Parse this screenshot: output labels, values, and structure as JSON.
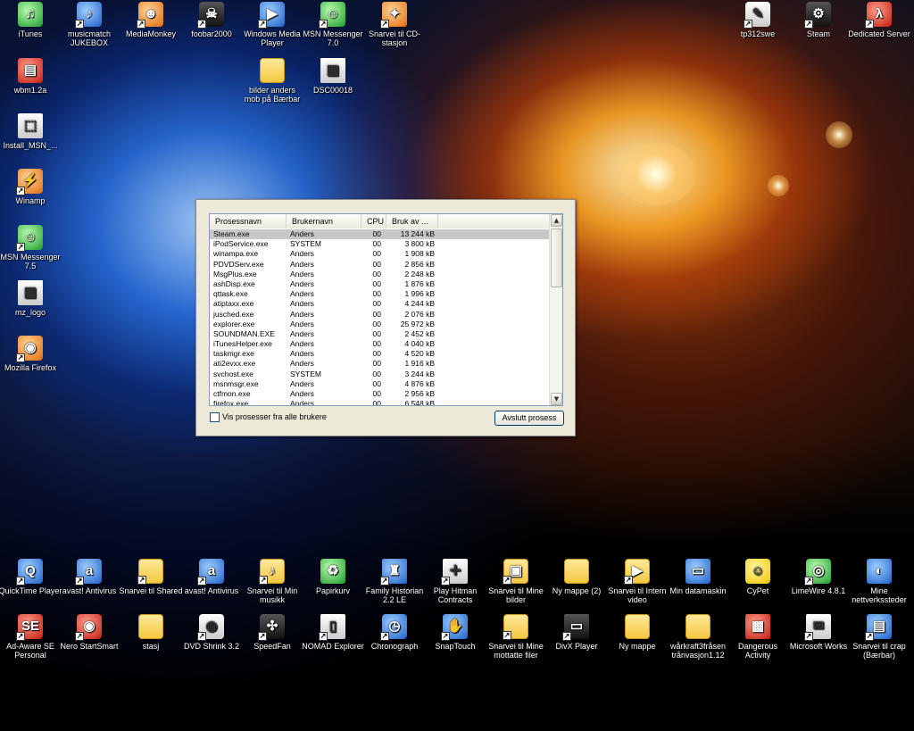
{
  "desktop": {
    "top_left": [
      {
        "label": "iTunes",
        "icon": "itunes-icon"
      },
      {
        "label": "musicmatch JUKEBOX",
        "icon": "musicmatch-icon"
      },
      {
        "label": "MediaMonkey",
        "icon": "mediamonkey-icon"
      },
      {
        "label": "foobar2000",
        "icon": "foobar-icon"
      },
      {
        "label": "Windows Media Player",
        "icon": "wmp-icon"
      },
      {
        "label": "MSN Messenger 7.0",
        "icon": "msn-icon"
      },
      {
        "label": "Snarvei til CD-stasjon",
        "icon": "cd-drive-icon"
      }
    ],
    "top_right": [
      {
        "label": "tp312swe",
        "icon": "tp312swe-icon"
      },
      {
        "label": "Steam",
        "icon": "steam-icon"
      },
      {
        "label": "Dedicated Server",
        "icon": "dedicated-server-icon"
      }
    ],
    "second_row": [
      {
        "label": "bilder anders mob på Bærbar",
        "icon": "folder-icon"
      },
      {
        "label": "DSC00018",
        "icon": "image-file-icon"
      }
    ],
    "left_column": [
      {
        "label": "wbm1.2a",
        "icon": "winrar-icon"
      },
      {
        "label": "Install_MSN_...",
        "icon": "installer-icon"
      },
      {
        "label": "Winamp",
        "icon": "winamp-icon"
      },
      {
        "label": "MSN Messenger 7.5",
        "icon": "msn-icon"
      },
      {
        "label": "mz_logo",
        "icon": "image-file-icon"
      },
      {
        "label": "Mozilla Firefox",
        "icon": "firefox-icon"
      }
    ],
    "bottom_row1": [
      {
        "label": "QuickTime Player",
        "icon": "quicktime-icon"
      },
      {
        "label": "avast! Antivirus",
        "icon": "avast-icon"
      },
      {
        "label": "Snarvei til Shared",
        "icon": "folder-icon"
      },
      {
        "label": "avast! Antivirus",
        "icon": "avast-icon"
      },
      {
        "label": "Snarvei til Min musikk",
        "icon": "music-folder-icon"
      },
      {
        "label": "Papirkurv",
        "icon": "recycle-bin-icon"
      },
      {
        "label": "Family Historian 2.2 LE",
        "icon": "family-historian-icon"
      },
      {
        "label": "Play Hitman Contracts",
        "icon": "hitman-icon"
      },
      {
        "label": "Snarvei til Mine bilder",
        "icon": "pictures-folder-icon"
      },
      {
        "label": "Ny mappe (2)",
        "icon": "folder-icon"
      },
      {
        "label": "Snarvei til Intern video",
        "icon": "video-folder-icon"
      },
      {
        "label": "Min datamaskin",
        "icon": "my-computer-icon"
      },
      {
        "label": "CyPet",
        "icon": "cypet-icon"
      },
      {
        "label": "LimeWire 4.8.1",
        "icon": "limewire-icon"
      },
      {
        "label": "Mine nettverkssteder",
        "icon": "network-places-icon"
      }
    ],
    "bottom_row2": [
      {
        "label": "Ad-Aware SE Personal",
        "icon": "adaware-icon"
      },
      {
        "label": "Nero StartSmart",
        "icon": "nero-icon"
      },
      {
        "label": "stasj",
        "icon": "folder-icon"
      },
      {
        "label": "DVD Shrink 3.2",
        "icon": "dvd-shrink-icon"
      },
      {
        "label": "SpeedFan",
        "icon": "speedfan-icon"
      },
      {
        "label": "NOMAD Explorer",
        "icon": "nomad-icon"
      },
      {
        "label": "Chronograph",
        "icon": "chronograph-icon"
      },
      {
        "label": "SnapTouch",
        "icon": "snaptouch-icon"
      },
      {
        "label": "Snarvei til Mine mottatte filer",
        "icon": "folder-icon"
      },
      {
        "label": "DivX Player",
        "icon": "divx-icon"
      },
      {
        "label": "Ny mappe",
        "icon": "folder-icon"
      },
      {
        "label": "wårkraft3fråsen trånvasjon1.12",
        "icon": "folder-icon"
      },
      {
        "label": "Dangerous Activity",
        "icon": "dangerous-activity-icon"
      },
      {
        "label": "Microsoft Works",
        "icon": "ms-works-icon"
      },
      {
        "label": "Snarvei til crap (Bærbar)",
        "icon": "network-folder-icon"
      }
    ]
  },
  "task_manager": {
    "columns": {
      "name": "Prosessnavn",
      "user": "Brukernavn",
      "cpu": "CPU",
      "mem": "Bruk av ..."
    },
    "processes": [
      {
        "name": "Steam.exe",
        "user": "Anders",
        "cpu": "00",
        "mem": "13 244 kB",
        "selected": true
      },
      {
        "name": "iPodService.exe",
        "user": "SYSTEM",
        "cpu": "00",
        "mem": "3 800 kB"
      },
      {
        "name": "winampa.exe",
        "user": "Anders",
        "cpu": "00",
        "mem": "1 908 kB"
      },
      {
        "name": "PDVDServ.exe",
        "user": "Anders",
        "cpu": "00",
        "mem": "2 856 kB"
      },
      {
        "name": "MsgPlus.exe",
        "user": "Anders",
        "cpu": "00",
        "mem": "2 248 kB"
      },
      {
        "name": "ashDisp.exe",
        "user": "Anders",
        "cpu": "00",
        "mem": "1 876 kB"
      },
      {
        "name": "qttask.exe",
        "user": "Anders",
        "cpu": "00",
        "mem": "1 996 kB"
      },
      {
        "name": "atiptaxx.exe",
        "user": "Anders",
        "cpu": "00",
        "mem": "4 244 kB"
      },
      {
        "name": "jusched.exe",
        "user": "Anders",
        "cpu": "00",
        "mem": "2 076 kB"
      },
      {
        "name": "explorer.exe",
        "user": "Anders",
        "cpu": "00",
        "mem": "25 972 kB"
      },
      {
        "name": "SOUNDMAN.EXE",
        "user": "Anders",
        "cpu": "00",
        "mem": "2 452 kB"
      },
      {
        "name": "iTunesHelper.exe",
        "user": "Anders",
        "cpu": "00",
        "mem": "4 040 kB"
      },
      {
        "name": "taskmgr.exe",
        "user": "Anders",
        "cpu": "00",
        "mem": "4 520 kB"
      },
      {
        "name": "ati2evxx.exe",
        "user": "Anders",
        "cpu": "00",
        "mem": "1 916 kB"
      },
      {
        "name": "svchost.exe",
        "user": "SYSTEM",
        "cpu": "00",
        "mem": "3 244 kB"
      },
      {
        "name": "msnmsgr.exe",
        "user": "Anders",
        "cpu": "00",
        "mem": "4 876 kB"
      },
      {
        "name": "ctfmon.exe",
        "user": "Anders",
        "cpu": "00",
        "mem": "2 956 kB"
      },
      {
        "name": "firefox.exe",
        "user": "Anders",
        "cpu": "00",
        "mem": "6 548 kB"
      }
    ],
    "show_all_label": "Vis prosesser fra alle brukere",
    "show_all_checked": false,
    "end_process_label": "Avslutt prosess"
  }
}
